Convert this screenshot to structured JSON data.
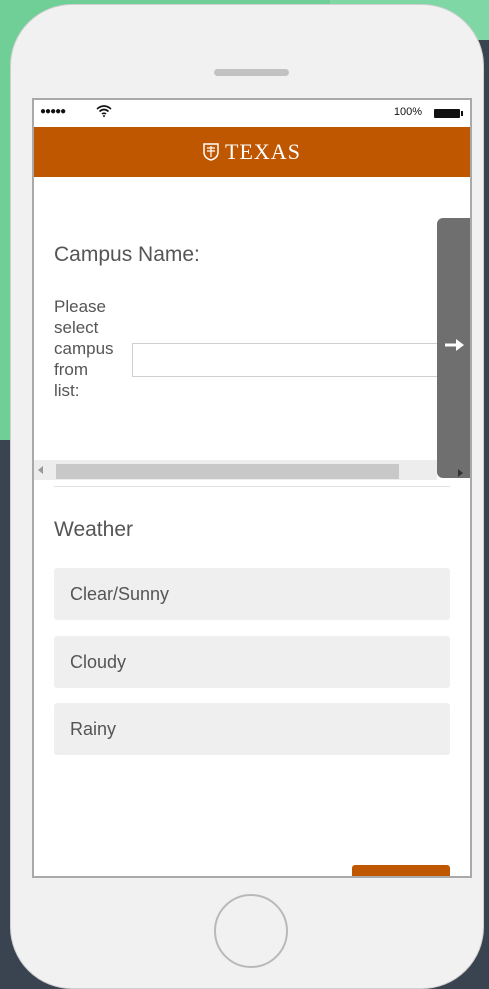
{
  "status_bar": {
    "signal": "●●●●●",
    "battery": "100%"
  },
  "header": {
    "brand": "TEXAS"
  },
  "campus": {
    "label": "Campus Name:",
    "help_lines": [
      "Please",
      "select",
      "campus",
      "from",
      "list:"
    ]
  },
  "weather": {
    "label": "Weather",
    "options": [
      "Clear/Sunny",
      "Cloudy",
      "Rainy"
    ]
  },
  "colors": {
    "brand": "#bf5700",
    "tab": "#6f6f6f"
  },
  "icons": {
    "wifi": "wifi-icon",
    "battery": "battery-icon",
    "shield": "shield-icon",
    "next": "arrow-right-icon"
  }
}
